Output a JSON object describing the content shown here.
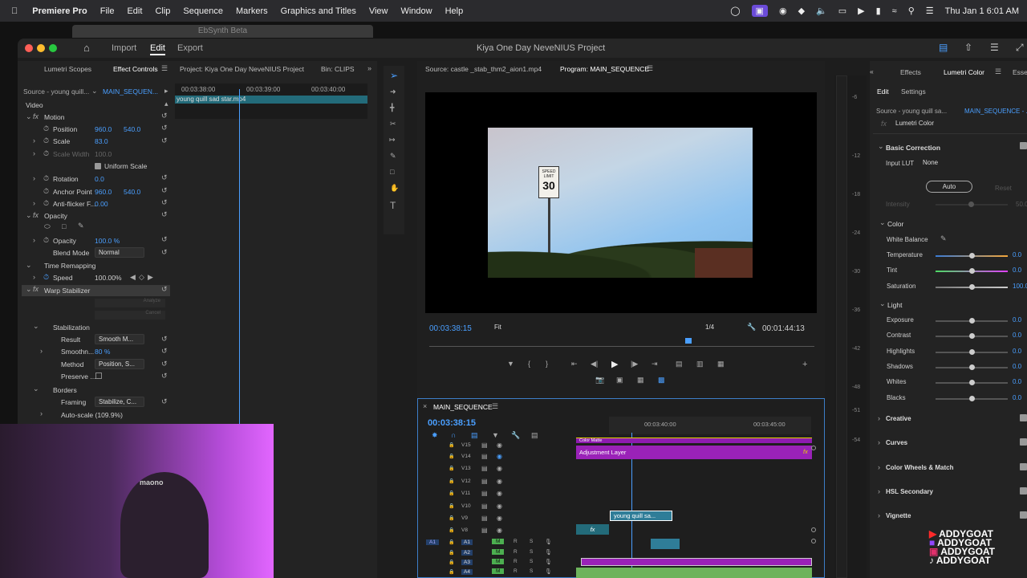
{
  "menubar": {
    "app": "Premiere Pro",
    "items": [
      "File",
      "Edit",
      "Clip",
      "Sequence",
      "Markers",
      "Graphics and Titles",
      "View",
      "Window",
      "Help"
    ],
    "datetime": "Thu Jan 1  6:01 AM"
  },
  "background_window": {
    "title": "EbSynth Beta"
  },
  "window": {
    "title": "Kiya One Day NeveNIUS Project",
    "header_tabs": [
      "Import",
      "Edit",
      "Export"
    ],
    "active_header_tab": "Edit"
  },
  "left_panel": {
    "tabs": [
      "Lumetri Scopes",
      "Effect Controls",
      "Project: Kiya One Day NeveNIUS Project",
      "Bin: CLIPS"
    ],
    "source_label": "Source - young quill...",
    "sequence_label": "MAIN_SEQUEN...",
    "timecodes": [
      "00:03:38:00",
      "00:03:39:00",
      "00:03:40:00"
    ],
    "clip_name": "young quill sad star.mp4",
    "video_label": "Video",
    "motion": {
      "label": "Motion",
      "position": {
        "label": "Position",
        "x": "960.0",
        "y": "540.0"
      },
      "scale": {
        "label": "Scale",
        "value": "83.0"
      },
      "scale_width": {
        "label": "Scale Width",
        "value": "100.0"
      },
      "uniform_scale": "Uniform Scale",
      "rotation": {
        "label": "Rotation",
        "value": "0.0"
      },
      "anchor": {
        "label": "Anchor Point",
        "x": "960.0",
        "y": "540.0"
      },
      "antiflicker": {
        "label": "Anti-flicker F...",
        "value": "0.00"
      }
    },
    "opacity": {
      "label": "Opacity",
      "opacity": {
        "label": "Opacity",
        "value": "100.0 %"
      },
      "blend": {
        "label": "Blend Mode",
        "value": "Normal"
      }
    },
    "time_remap": {
      "label": "Time Remapping",
      "speed_label": "Speed",
      "speed": "100.00%"
    },
    "warp": {
      "label": "Warp Stabilizer",
      "analyze": "Analyze",
      "cancel": "Cancel",
      "stabilization": "Stabilization",
      "result": {
        "label": "Result",
        "value": "Smooth M..."
      },
      "smoothness": {
        "label": "Smoothn...",
        "value": "80 %"
      },
      "method": {
        "label": "Method",
        "value": "Position, S..."
      },
      "preserve": "Preserve ...",
      "borders": "Borders",
      "framing": {
        "label": "Framing",
        "value": "Stabilize, C..."
      },
      "autoscale": "Auto-scale (109.9%)"
    }
  },
  "source_monitor": {
    "tab": "Source: castle _stab_thm2_aion1.mp4"
  },
  "program": {
    "tab": "Program: MAIN_SEQUENCE",
    "timecode": "00:03:38:15",
    "fit": "Fit",
    "quality": "1/4",
    "duration": "00:01:44:13",
    "sign_top": "SPEED LIMIT",
    "sign_num": "30"
  },
  "timeline": {
    "tab": "MAIN_SEQUENCE",
    "timecode": "00:03:38:15",
    "ruler": [
      "00:03:40:00",
      "00:03:45:00"
    ],
    "tracks": [
      "V15",
      "V14",
      "V13",
      "V12",
      "V11",
      "V10",
      "V9",
      "V8",
      "A1",
      "A2",
      "A3",
      "A4"
    ],
    "source_patch": "A1",
    "clips": {
      "color_matte": "Color Matte",
      "adjustment": "Adjustment Layer",
      "young": "young quill sa...",
      "fx": "fx"
    }
  },
  "right_panel": {
    "tabs": [
      "Effects",
      "Lumetri Color",
      "Esse"
    ],
    "subtabs": [
      "Edit",
      "Settings"
    ],
    "source_label": "Source - young quill sa...",
    "sequence_label": "MAIN_SEQUENCE - ...",
    "effect_dropdown": "Lumetri Color",
    "basic_correction": "Basic Correction",
    "input_lut": {
      "label": "Input LUT",
      "value": "None"
    },
    "auto": "Auto",
    "reset": "Reset",
    "intensity": {
      "label": "Intensity",
      "value": "50.0"
    },
    "color_section": "Color",
    "white_balance": "White Balance",
    "color_rows": [
      {
        "label": "Temperature",
        "value": "0.0",
        "frac": 0.5
      },
      {
        "label": "Tint",
        "value": "0.0",
        "frac": 0.5
      },
      {
        "label": "Saturation",
        "value": "100.0",
        "frac": 0.5
      }
    ],
    "light_section": "Light",
    "light_rows": [
      {
        "label": "Exposure",
        "value": "0.0",
        "frac": 0.5
      },
      {
        "label": "Contrast",
        "value": "0.0",
        "frac": 0.5
      },
      {
        "label": "Highlights",
        "value": "0.0",
        "frac": 0.5
      },
      {
        "label": "Shadows",
        "value": "0.0",
        "frac": 0.5
      },
      {
        "label": "Whites",
        "value": "0.0",
        "frac": 0.5
      },
      {
        "label": "Blacks",
        "value": "0.0",
        "frac": 0.5
      }
    ],
    "sections": [
      "Creative",
      "Curves",
      "Color Wheels & Match",
      "HSL Secondary",
      "Vignette"
    ]
  },
  "audio_meter": {
    "ticks": [
      "-6",
      "-12",
      "-18",
      "-24",
      "-30",
      "-36",
      "-42",
      "-48",
      "-51",
      "-54"
    ]
  },
  "overlay": {
    "webcam_text": "maono",
    "watermark": [
      "ADDYGOAT",
      "ADDYGOAT",
      "ADDYGOAT",
      "ADDYGOAT"
    ]
  }
}
